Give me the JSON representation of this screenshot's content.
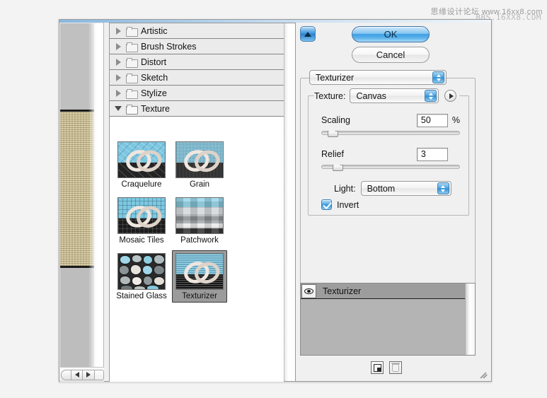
{
  "watermark": {
    "line1": "思缘设计论坛 www.16xx8.com",
    "line2": "BBS.16XX8.COM"
  },
  "preview": {
    "zoom_out_label": "zoom-out",
    "zoom_in_label": "zoom-in"
  },
  "filter_list": {
    "categories": [
      {
        "label": "Artistic",
        "expanded": false
      },
      {
        "label": "Brush Strokes",
        "expanded": false
      },
      {
        "label": "Distort",
        "expanded": false
      },
      {
        "label": "Sketch",
        "expanded": false
      },
      {
        "label": "Stylize",
        "expanded": false
      },
      {
        "label": "Texture",
        "expanded": true
      }
    ],
    "thumbnails": [
      {
        "label": "Craquelure",
        "style": "t-craquelure",
        "selected": false
      },
      {
        "label": "Grain",
        "style": "t-grain",
        "selected": false
      },
      {
        "label": "Mosaic Tiles",
        "style": "t-mosaic",
        "selected": false
      },
      {
        "label": "Patchwork",
        "style": "t-patchwork",
        "selected": false
      },
      {
        "label": "Stained Glass",
        "style": "t-stained",
        "selected": false
      },
      {
        "label": "Texturizer",
        "style": "t-texturizer",
        "selected": true
      }
    ]
  },
  "buttons": {
    "ok": "OK",
    "cancel": "Cancel"
  },
  "settings": {
    "filter_name": "Texturizer",
    "texture_label": "Texture:",
    "texture_value": "Canvas",
    "scaling_label": "Scaling",
    "scaling_value": "50",
    "scaling_unit": "%",
    "scaling_percent": 20,
    "relief_label": "Relief",
    "relief_value": "3",
    "relief_percent": 12,
    "light_label": "Light:",
    "light_value": "Bottom",
    "invert_label": "Invert",
    "invert_checked": true
  },
  "effect_stack": {
    "rows": [
      {
        "label": "Texturizer",
        "visible": true
      }
    ],
    "new_button": "new-effect-layer",
    "delete_button": "delete-effect-layer"
  },
  "colors": {
    "accent_blue": "#3d9fe4",
    "panel_gray": "#f0f0f0",
    "list_gray": "#b4b4b4",
    "canvas_tan": "#cbbd8c"
  }
}
